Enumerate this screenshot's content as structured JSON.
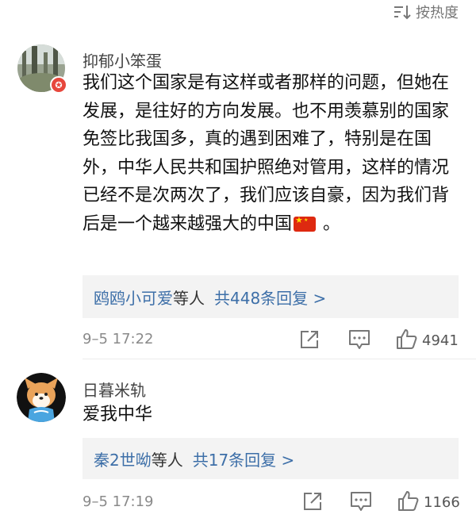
{
  "sort": {
    "label": "按热度",
    "icon": "sort-icon"
  },
  "comments": [
    {
      "username": "抑郁小笨蛋",
      "avatar": "forest-photo-avatar",
      "badge_icon": "star-badge-icon",
      "badge": "✪",
      "text_before_flag": "我们这个国家是有这样或者那样的问题，但她在发展，是往好的方向发展。也不用羡慕别的国家免签比我国多，真的遇到困难了，特别是在国外，中华人民共和国护照绝对管用，这样的情况已经不是次两次了，我们应该自豪，因为我们背后是一个越来越强大的中国",
      "flag_icon": "china-flag-icon",
      "text_after_flag": " 。",
      "replies": {
        "names": "鸥鸥小可爱",
        "suffix": "等人",
        "total": "共448条回复 >"
      },
      "time": "9–5 17:22",
      "likes": "4941"
    },
    {
      "username": "日暮米轨",
      "avatar": "shiba-dog-avatar",
      "text_before_flag": "爱我中华",
      "text_after_flag": "",
      "replies": {
        "names": "秦2世呦",
        "suffix": "等人",
        "total": "共17条回复 >"
      },
      "time": "9–5 17:19",
      "likes": "1166"
    }
  ],
  "icons": {
    "share": "share-icon",
    "comment": "comment-icon",
    "like": "thumbs-up-icon"
  }
}
